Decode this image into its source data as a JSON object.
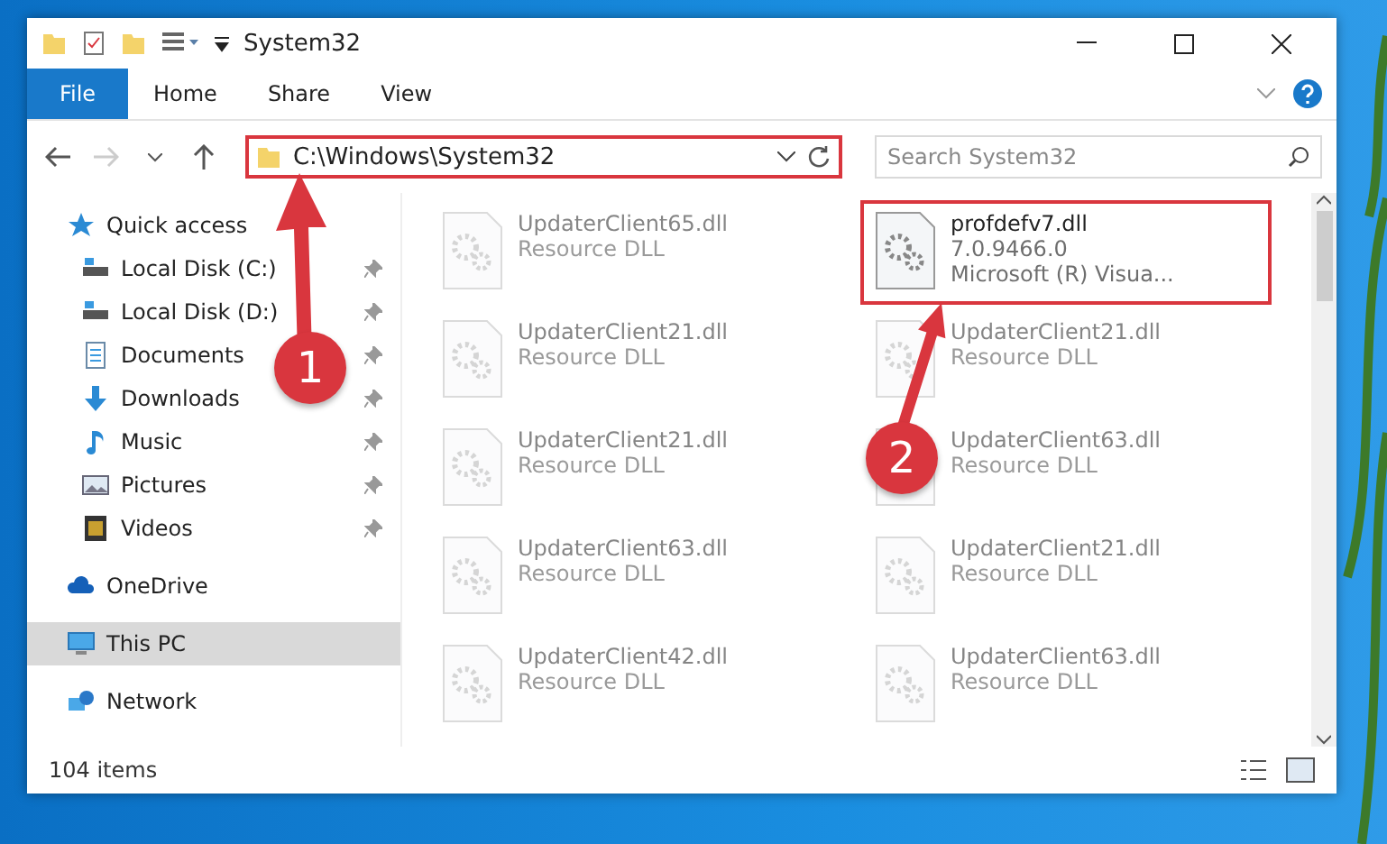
{
  "window": {
    "title": "System32"
  },
  "ribbon": {
    "file_tab": "File",
    "tabs": [
      {
        "label": "Home",
        "selected": false
      },
      {
        "label": "Share",
        "selected": false
      },
      {
        "label": "View",
        "selected": false
      }
    ]
  },
  "address": {
    "path": "C:\\Windows\\System32",
    "highlighted": true
  },
  "search": {
    "placeholder": "Search System32"
  },
  "sidebar": {
    "items": [
      {
        "label": "Quick access",
        "kind": "star",
        "pinned": false,
        "selected": false,
        "children": [
          {
            "label": "Local Disk (C:)",
            "kind": "disk",
            "pinned": true,
            "selected": false
          },
          {
            "label": "Local Disk (D:)",
            "kind": "disk",
            "pinned": true,
            "selected": false
          },
          {
            "label": "Documents",
            "kind": "document",
            "pinned": true,
            "selected": false
          },
          {
            "label": "Downloads",
            "kind": "download",
            "pinned": true,
            "selected": false
          },
          {
            "label": "Music",
            "kind": "music",
            "pinned": true,
            "selected": false
          },
          {
            "label": "Pictures",
            "kind": "picture",
            "pinned": true,
            "selected": false
          },
          {
            "label": "Videos",
            "kind": "video",
            "pinned": true,
            "selected": false
          }
        ]
      },
      {
        "label": "OneDrive",
        "kind": "cloud",
        "pinned": false,
        "selected": false
      },
      {
        "label": "This PC",
        "kind": "computer",
        "pinned": false,
        "selected": true
      },
      {
        "label": "Network",
        "kind": "network",
        "pinned": false,
        "selected": false
      }
    ]
  },
  "files": [
    {
      "name": "UpdaterClient65.dll",
      "lines": [
        "Resource DLL"
      ],
      "faded": true,
      "highlighted": false
    },
    {
      "name": "profdefv7.dll",
      "lines": [
        "7.0.9466.0",
        "Microsoft (R) Visua..."
      ],
      "faded": false,
      "highlighted": true
    },
    {
      "name": "UpdaterClient21.dll",
      "lines": [
        "Resource DLL"
      ],
      "faded": true,
      "highlighted": false
    },
    {
      "name": "UpdaterClient21.dll",
      "lines": [
        "Resource DLL"
      ],
      "faded": true,
      "highlighted": false
    },
    {
      "name": "UpdaterClient21.dll",
      "lines": [
        "Resource DLL"
      ],
      "faded": true,
      "highlighted": false
    },
    {
      "name": "UpdaterClient63.dll",
      "lines": [
        "Resource DLL"
      ],
      "faded": true,
      "highlighted": false
    },
    {
      "name": "UpdaterClient63.dll",
      "lines": [
        "Resource DLL"
      ],
      "faded": true,
      "highlighted": false
    },
    {
      "name": "UpdaterClient21.dll",
      "lines": [
        "Resource DLL"
      ],
      "faded": true,
      "highlighted": false
    },
    {
      "name": "UpdaterClient42.dll",
      "lines": [
        "Resource DLL"
      ],
      "faded": true,
      "highlighted": false
    },
    {
      "name": "UpdaterClient63.dll",
      "lines": [
        "Resource DLL"
      ],
      "faded": true,
      "highlighted": false
    }
  ],
  "status_bar": {
    "count": "104 items"
  },
  "annotations": [
    {
      "number": "1"
    },
    {
      "number": "2"
    }
  ]
}
